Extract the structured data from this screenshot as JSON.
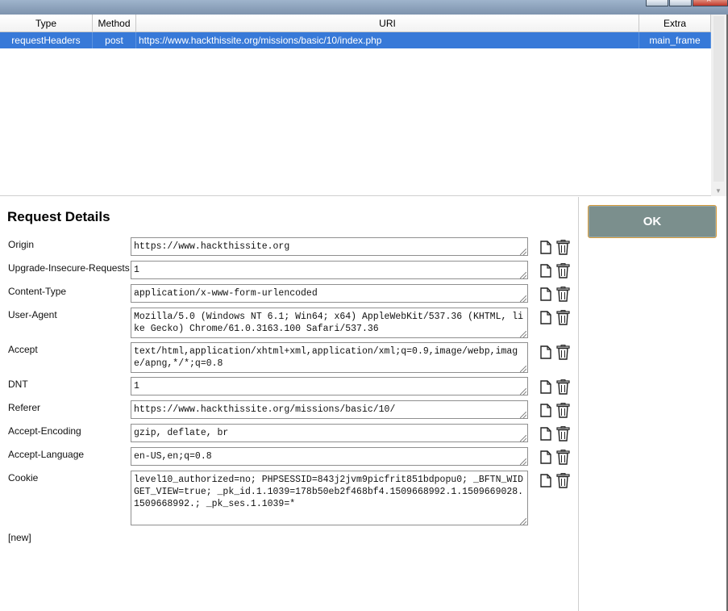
{
  "table": {
    "headers": [
      "Type",
      "Method",
      "URI",
      "Extra"
    ],
    "rows": [
      {
        "type": "requestHeaders",
        "method": "post",
        "uri": "https://www.hackthissite.org/missions/basic/10/index.php",
        "extra": "main_frame"
      }
    ]
  },
  "details": {
    "title": "Request Details",
    "headers": [
      {
        "name": "Origin",
        "value": "https://www.hackthissite.org"
      },
      {
        "name": "Upgrade-Insecure-Requests",
        "value": "1"
      },
      {
        "name": "Content-Type",
        "value": "application/x-www-form-urlencoded"
      },
      {
        "name": "User-Agent",
        "value": "Mozilla/5.0 (Windows NT 6.1; Win64; x64) AppleWebKit/537.36 (KHTML, like Gecko) Chrome/61.0.3163.100 Safari/537.36"
      },
      {
        "name": "Accept",
        "value": "text/html,application/xhtml+xml,application/xml;q=0.9,image/webp,image/apng,*/*;q=0.8"
      },
      {
        "name": "DNT",
        "value": "1"
      },
      {
        "name": "Referer",
        "value": "https://www.hackthissite.org/missions/basic/10/"
      },
      {
        "name": "Accept-Encoding",
        "value": "gzip, deflate, br"
      },
      {
        "name": "Accept-Language",
        "value": "en-US,en;q=0.8"
      },
      {
        "name": "Cookie",
        "value": "level10_authorized=no; PHPSESSID=843j2jvm9picfrit851bdpopu0; _BFTN_WIDGET_VIEW=true; _pk_id.1.1039=178b50eb2f468bf4.1509668992.1.1509669028.1509668992.; _pk_ses.1.1039=*"
      }
    ],
    "new_label": "[new]"
  },
  "ok_label": "OK"
}
